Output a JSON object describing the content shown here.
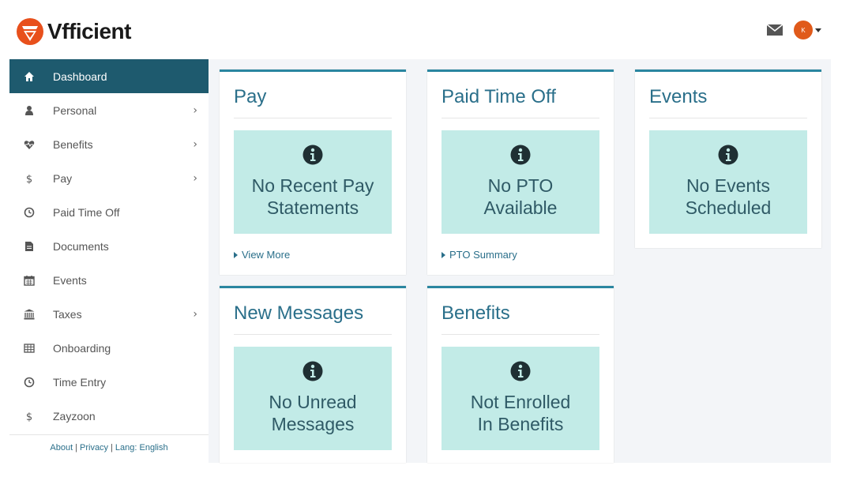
{
  "app": {
    "brand": "Vfficient"
  },
  "header": {
    "avatar_initial": "K",
    "mail_icon": "envelope-icon"
  },
  "sidebar": {
    "items": [
      {
        "label": "Dashboard",
        "icon": "home-icon",
        "active": true,
        "chevron": ""
      },
      {
        "label": "Personal",
        "icon": "user-icon",
        "chevron": "›"
      },
      {
        "label": "Benefits",
        "icon": "heartbeat-icon",
        "chevron": "›"
      },
      {
        "label": "Pay",
        "icon": "dollar-icon",
        "chevron": "›"
      },
      {
        "label": "Paid Time Off",
        "icon": "clock-icon",
        "chevron": ""
      },
      {
        "label": "Documents",
        "icon": "file-icon",
        "chevron": ""
      },
      {
        "label": "Events",
        "icon": "calendar-icon",
        "chevron": ""
      },
      {
        "label": "Taxes",
        "icon": "bank-icon",
        "chevron": "›"
      },
      {
        "label": "Onboarding",
        "icon": "table-icon",
        "chevron": ""
      },
      {
        "label": "Time Entry",
        "icon": "clock-icon",
        "chevron": ""
      },
      {
        "label": "Zayzoon",
        "icon": "dollar-icon",
        "chevron": ""
      }
    ],
    "footer": {
      "about": "About",
      "privacy": "Privacy",
      "lang": "Lang: English",
      "sep": "|"
    }
  },
  "cards": {
    "pay": {
      "title": "Pay",
      "message": "No Recent Pay\nStatements",
      "link": "View More"
    },
    "pto": {
      "title": "Paid Time Off",
      "message": "No PTO\nAvailable",
      "link": "PTO Summary"
    },
    "events": {
      "title": "Events",
      "message": "No Events\nScheduled"
    },
    "messages": {
      "title": "New Messages",
      "message": "No Unread\nMessages"
    },
    "benefits": {
      "title": "Benefits",
      "message": "Not Enrolled\nIn Benefits"
    }
  },
  "colors": {
    "accent": "#1e5a6e",
    "card_border": "#2a86a0",
    "box_bg": "#c2ebe7",
    "brand_orange": "#e05a1a"
  }
}
